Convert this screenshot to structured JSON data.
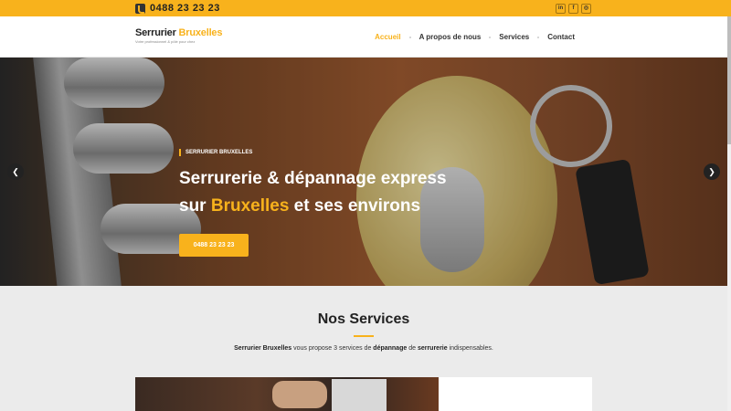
{
  "topbar": {
    "phone_icon": "phone-icon",
    "phone": "0488 23 23 23",
    "socials": [
      {
        "icon": "linkedin-icon",
        "glyph": "in"
      },
      {
        "icon": "facebook-icon",
        "glyph": "f"
      },
      {
        "icon": "instagram-icon",
        "glyph": "◎"
      }
    ],
    "accent_color": "#f8b21c"
  },
  "header": {
    "logo_part1": "Serrurier ",
    "logo_part2": "Bruxelles",
    "logo_tagline": "Votre professionnel & pôle pour chez",
    "nav": [
      "Accueil",
      "A propos de nous",
      "Services",
      "Contact"
    ],
    "active": "Accueil"
  },
  "hero": {
    "tag": "SERRURIER BRUXELLES",
    "title_line1": "Serrurerie & dépannage express",
    "title_line2_pre": "sur ",
    "title_line2_accent": "Bruxelles",
    "title_line2_post": " et ses environs",
    "button": "0488 23 23 23",
    "prev_icon": "chevron-left-icon",
    "next_icon": "chevron-right-icon"
  },
  "services": {
    "title": "Nos Services",
    "desc_b1": "Serrurier Bruxelles",
    "desc_t1": " vous propose 3 services de ",
    "desc_b2": "dépannage",
    "desc_t2": " de ",
    "desc_b3": "serrurerie",
    "desc_t3": " indispensables."
  }
}
